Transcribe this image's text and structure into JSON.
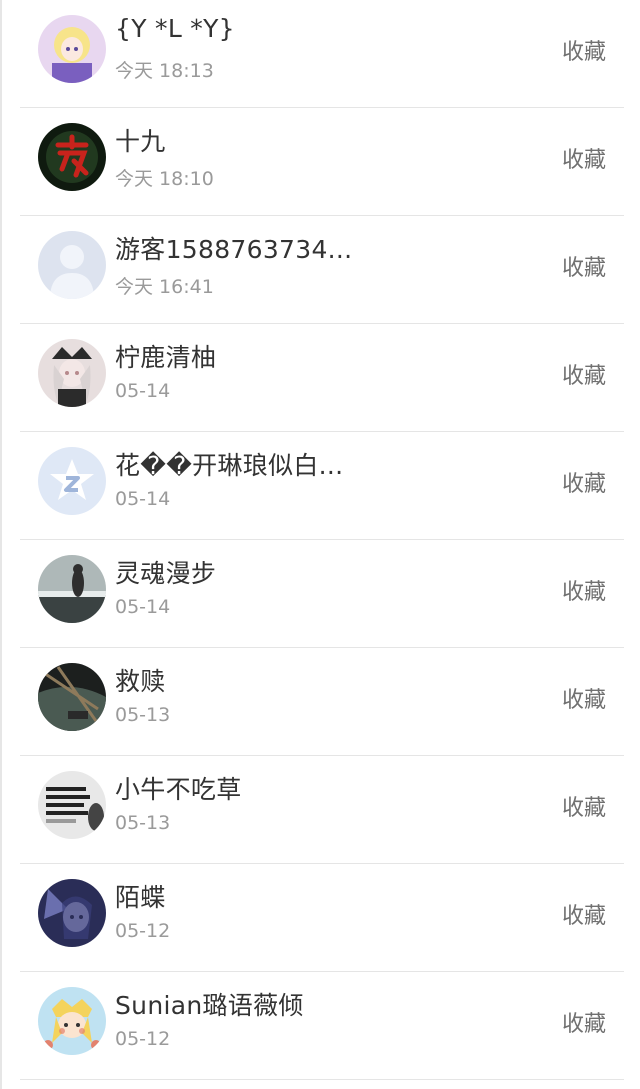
{
  "contacts": [
    {
      "name": "{Y *L *Y}",
      "time": "今天 18:13",
      "action": "收藏",
      "avatar_icon": "anime-girl-avatar-icon",
      "colors": [
        "#e8d7f0",
        "#f7e48a",
        "#7a5fbf"
      ]
    },
    {
      "name": "十九",
      "time": "今天 18:10",
      "action": "收藏",
      "avatar_icon": "night-character-avatar-icon",
      "colors": [
        "#0f1a0f",
        "#c8231c",
        "#2d4f2a"
      ]
    },
    {
      "name": "游客1588763734...",
      "time": "今天 16:41",
      "action": "收藏",
      "avatar_icon": "default-user-avatar-icon",
      "colors": [
        "#dde3ef",
        "#f1f4fa",
        "#dde3ef"
      ]
    },
    {
      "name": "柠鹿清柚",
      "time": "05-14",
      "action": "收藏",
      "avatar_icon": "anime-girl-avatar-icon",
      "colors": [
        "#e7dede",
        "#2b2b2b",
        "#b7898c"
      ]
    },
    {
      "name": "花��开琳琅似白...",
      "time": "05-14",
      "action": "收藏",
      "avatar_icon": "qq-star-avatar-icon",
      "colors": [
        "#dfe8f6",
        "#ffffff",
        "#9fb5da"
      ]
    },
    {
      "name": "灵魂漫步",
      "time": "05-14",
      "action": "收藏",
      "avatar_icon": "photo-avatar-icon",
      "colors": [
        "#aeb8b8",
        "#3a4242",
        "#e7ecec"
      ]
    },
    {
      "name": "救赎",
      "time": "05-13",
      "action": "收藏",
      "avatar_icon": "photo-avatar-icon",
      "colors": [
        "#1c1f1e",
        "#8e7a5b",
        "#4a5a52"
      ]
    },
    {
      "name": "小牛不吃草",
      "time": "05-13",
      "action": "收藏",
      "avatar_icon": "text-image-avatar-icon",
      "colors": [
        "#e8e8e8",
        "#222222",
        "#9a9a9a"
      ]
    },
    {
      "name": "陌蝶",
      "time": "05-12",
      "action": "收藏",
      "avatar_icon": "anime-girl-avatar-icon",
      "colors": [
        "#2a2d57",
        "#c9c9e6",
        "#6a6fae"
      ]
    },
    {
      "name": "Sunian璐语薇倾",
      "time": "05-12",
      "action": "收藏",
      "avatar_icon": "cartoon-avatar-icon",
      "colors": [
        "#bfe2f2",
        "#f4d35c",
        "#e3826e"
      ]
    }
  ]
}
